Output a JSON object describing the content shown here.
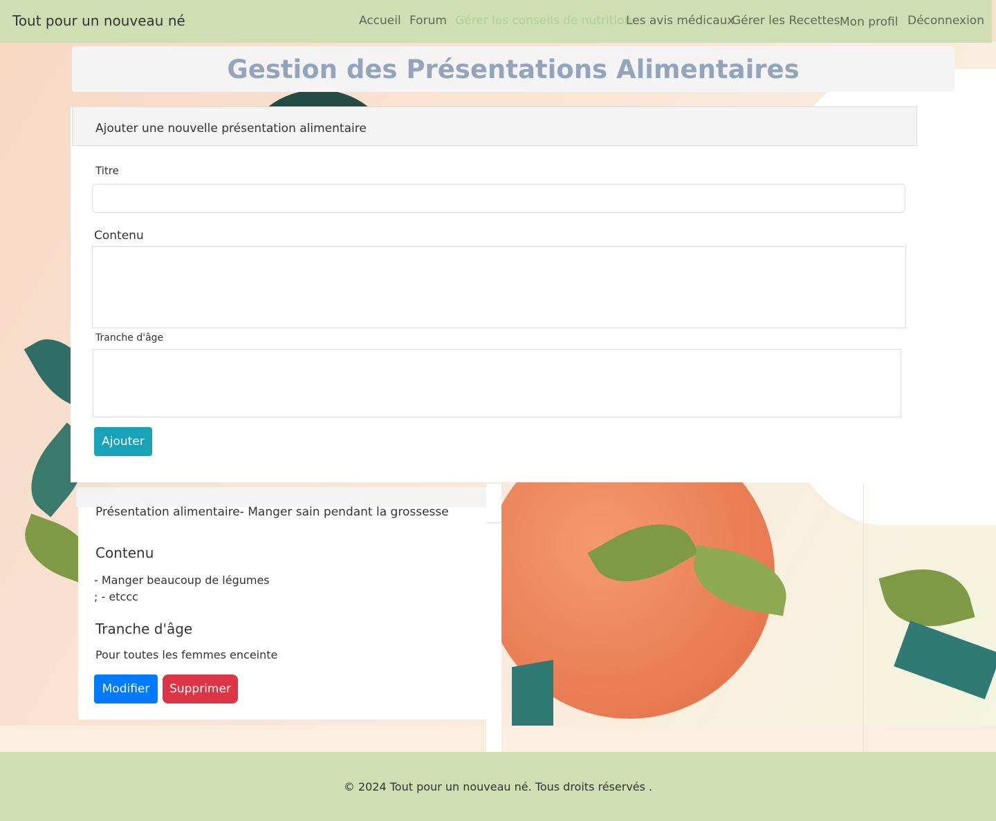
{
  "navbar": {
    "brand": "Tout pour un nouveau né",
    "links": [
      {
        "label": "Accueil",
        "active": false
      },
      {
        "label": "Forum",
        "active": false
      },
      {
        "label": "Gérer les conseils de nutrition",
        "active": true
      },
      {
        "label": "Les avis médicaux",
        "active": false
      },
      {
        "label": "Gérer les Recettes",
        "active": false
      },
      {
        "label": "Mon profil",
        "active": false
      },
      {
        "label": "Déconnexion",
        "active": false
      }
    ]
  },
  "page": {
    "title": "Gestion des Présentations Alimentaires"
  },
  "form": {
    "header": "Ajouter une nouvelle présentation alimentaire",
    "titre_label": "Titre",
    "titre_value": "",
    "contenu_label": "Contenu",
    "contenu_value": "",
    "tranche_label": "Tranche d'âge",
    "tranche_value": "",
    "submit_label": "Ajouter"
  },
  "items": [
    {
      "title": "Présentation alimentaire- Manger sain pendant la grossesse",
      "contenu_heading": "Contenu",
      "contenu_lines": [
        "- Manger beaucoup de légumes",
        "; - etccc"
      ],
      "tranche_heading": "Tranche d'âge",
      "tranche_text": "Pour toutes les femmes enceinte",
      "edit_label": "Modifier",
      "delete_label": "Supprimer"
    }
  ],
  "footer": {
    "text": "© 2024 Tout pour un nouveau né. Tous droits réservés ."
  },
  "colors": {
    "navbar_bg": "#cfdeb3",
    "nav_active": "#b3cf9a",
    "title_color": "#93a4bb",
    "btn_ajouter": "#17a2b8",
    "btn_modifier": "#007bff",
    "btn_supprimer": "#dc3545"
  }
}
